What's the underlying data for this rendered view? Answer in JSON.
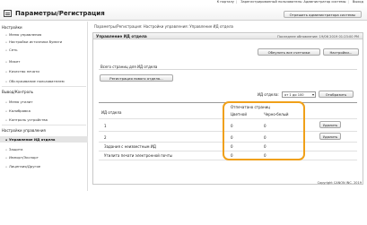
{
  "topbar": {
    "links": [
      "К порталу",
      "Зарегистрированный пользователь: Администратор системы",
      "Выход"
    ]
  },
  "header": {
    "title": "Параметры/Регистрация",
    "logout_button": "Отрешить администратора системы"
  },
  "sidebar": {
    "group1": "Настройки",
    "items1": [
      "Меню управления",
      "Настройки источника бумаги",
      "Сеть",
      "Макет",
      "Качество печати",
      "Обслуживание пользователем"
    ],
    "group2": "Вывод/Контроль",
    "items2": [
      "Меню утилит",
      "Калибровка",
      "Контроль устройства"
    ],
    "group3": "Настройки управления",
    "items3": [
      "Управление ИД отдела",
      "Защита",
      "Импорт/Экспорт",
      "Лицензия/Другое"
    ]
  },
  "breadcrumb": "Параметры/Регистрация: Настройки управления: Управление ИД отдела",
  "panel": {
    "title": "Управление ИД отдела",
    "last_updated": "Последнее обновление: 19/06 2019 01:23:00 PM",
    "refresh_button": "Обнулить все счетчики",
    "settings_button": "Настройки...",
    "section_title": "Всего страниц для ИД отдела",
    "register_button": "Регистрация нового отдела...",
    "id_label": "ИД отдела:",
    "id_select": "от 1 до 100",
    "display_button": "Отобразить",
    "col_dept": "ИД отдела",
    "col_printed": "Отпечатано страниц",
    "col_color": "Цветной",
    "col_bw": "Черно-белый",
    "rows": [
      {
        "id": "1",
        "color": "0",
        "bw": "0",
        "action": "Удалить"
      },
      {
        "id": "2",
        "color": "0",
        "bw": "0",
        "action": "Удалить"
      },
      {
        "id": "Задания с неизвестным ИД",
        "color": "0",
        "bw": "0",
        "action": ""
      },
      {
        "id": "Утилита печати электронной почты",
        "color": "0",
        "bw": "0",
        "action": ""
      }
    ]
  },
  "copyright": "Copyright CANON INC. 2019",
  "colors": {
    "highlight": "#f0a019"
  }
}
